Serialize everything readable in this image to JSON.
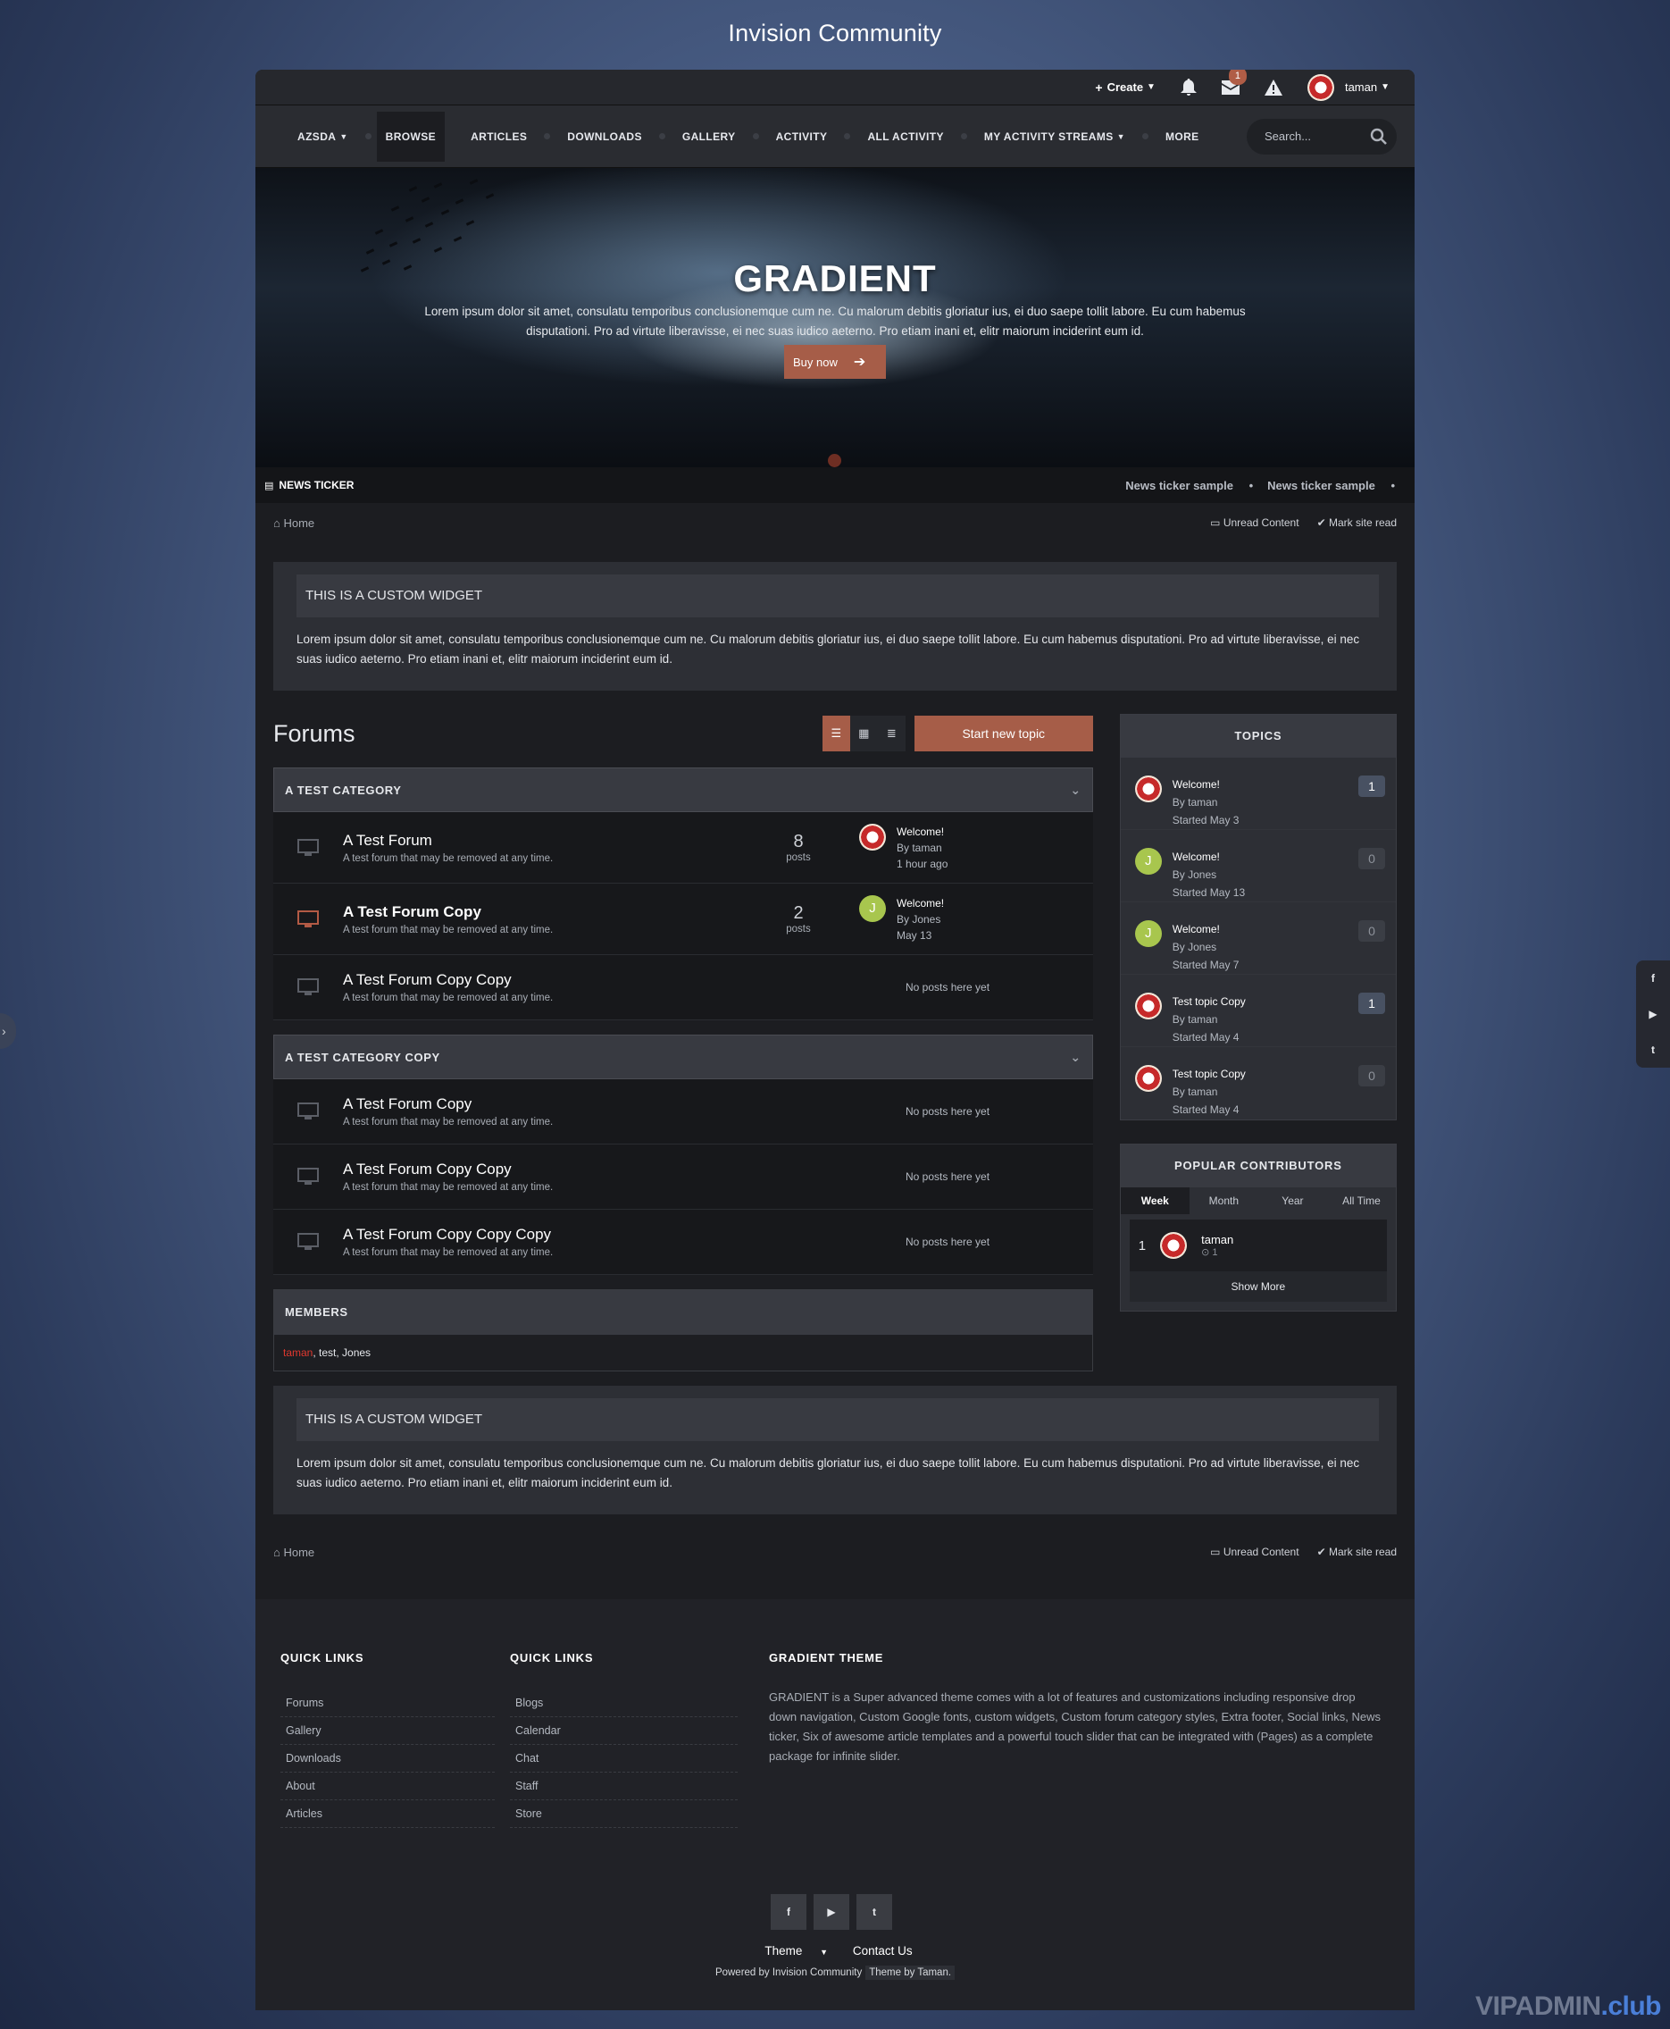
{
  "site_title": "Invision Community",
  "userbar": {
    "create": "Create",
    "messages_badge": "1",
    "username": "taman"
  },
  "nav": {
    "items": [
      "AZSDA",
      "BROWSE",
      "ARTICLES",
      "DOWNLOADS",
      "GALLERY",
      "ACTIVITY",
      "ALL ACTIVITY",
      "MY ACTIVITY STREAMS",
      "MORE"
    ],
    "search_placeholder": "Search..."
  },
  "hero": {
    "title": "GRADIENT",
    "text": "Lorem ipsum dolor sit amet, consulatu temporibus conclusionemque cum ne. Cu malorum debitis gloriatur ius, ei duo saepe tollit labore. Eu cum habemus disputationi. Pro ad virtute liberavisse, ei nec suas iudico aeterno. Pro etiam inani et, elitr maiorum inciderint eum id.",
    "button": "Buy now"
  },
  "ticker": {
    "label": "NEWS TICKER",
    "items": [
      "News ticker sample",
      "News ticker sample"
    ]
  },
  "breadcrumb": {
    "home": "Home",
    "unread": "Unread Content",
    "mark_read": "Mark site read"
  },
  "widget": {
    "title": "THIS IS A CUSTOM WIDGET",
    "text": "Lorem ipsum dolor sit amet, consulatu temporibus conclusionemque cum ne. Cu malorum debitis gloriatur ius, ei duo saepe tollit labore. Eu cum habemus disputationi. Pro ad virtute liberavisse, ei nec suas iudico aeterno. Pro etiam inani et, elitr maiorum inciderint eum id."
  },
  "forums": {
    "title": "Forums",
    "new_topic": "Start new topic",
    "categories": [
      {
        "name": "A TEST CATEGORY",
        "forums": [
          {
            "title": "A Test Forum",
            "desc": "A test forum that may be removed at any time.",
            "count": "8",
            "count_label": "posts",
            "last_title": "Welcome!",
            "last_by": "By taman",
            "last_time": "1 hour ago"
          },
          {
            "title": "A Test Forum Copy",
            "desc": "A test forum that may be removed at any time.",
            "count": "2",
            "count_label": "posts",
            "last_title": "Welcome!",
            "last_by": "By Jones",
            "last_time": "May 13"
          },
          {
            "title": "A Test Forum Copy Copy",
            "desc": "A test forum that may be removed at any time.",
            "none": "No posts here yet"
          }
        ]
      },
      {
        "name": "A TEST CATEGORY COPY",
        "forums": [
          {
            "title": "A Test Forum Copy",
            "desc": "A test forum that may be removed at any time.",
            "none": "No posts here yet"
          },
          {
            "title": "A Test Forum Copy Copy",
            "desc": "A test forum that may be removed at any time.",
            "none": "No posts here yet"
          },
          {
            "title": "A Test Forum Copy Copy Copy",
            "desc": "A test forum that may be removed at any time.",
            "none": "No posts here yet"
          }
        ]
      }
    ]
  },
  "members": {
    "title": "MEMBERS",
    "first": "taman",
    "rest": ", test, Jones"
  },
  "topics": {
    "title": "TOPICS",
    "items": [
      {
        "title": "Welcome!",
        "by": "By taman",
        "started": "Started May 3",
        "count": "1",
        "avatar_letter": ""
      },
      {
        "title": "Welcome!",
        "by": "By Jones",
        "started": "Started May 13",
        "count": "0",
        "avatar_letter": "J"
      },
      {
        "title": "Welcome!",
        "by": "By Jones",
        "started": "Started May 7",
        "count": "0",
        "avatar_letter": "J"
      },
      {
        "title": "Test topic Copy",
        "by": "By taman",
        "started": "Started May 4",
        "count": "1",
        "avatar_letter": ""
      },
      {
        "title": "Test topic Copy",
        "by": "By taman",
        "started": "Started May 4",
        "count": "0",
        "avatar_letter": ""
      }
    ]
  },
  "popular": {
    "title": "POPULAR CONTRIBUTORS",
    "tabs": [
      "Week",
      "Month",
      "Year",
      "All Time"
    ],
    "rank": "1",
    "name": "taman",
    "rep": "1",
    "show_more": "Show More"
  },
  "widget2": {
    "title": "THIS IS A CUSTOM WIDGET",
    "text": "Lorem ipsum dolor sit amet, consulatu temporibus conclusionemque cum ne. Cu malorum debitis gloriatur ius, ei duo saepe tollit labore. Eu cum habemus disputationi. Pro ad virtute liberavisse, ei nec suas iudico aeterno. Pro etiam inani et, elitr maiorum inciderint eum id."
  },
  "footer": {
    "col1_title": "QUICK LINKS",
    "col1": [
      "Forums",
      "Gallery",
      "Downloads",
      "About",
      "Articles"
    ],
    "col2_title": "QUICK LINKS",
    "col2": [
      "Blogs",
      "Calendar",
      "Chat",
      "Staff",
      "Store"
    ],
    "about_title": "GRADIENT THEME",
    "about_text": "GRADIENT is a Super advanced theme comes with a lot of features and customizations including responsive drop down navigation, Custom Google fonts, custom widgets, Custom forum category styles, Extra footer, Social links, News ticker, Six of awesome article templates and a powerful touch slider that can be integrated with (Pages) as a complete package for infinite slider.",
    "theme": "Theme",
    "contact": "Contact Us",
    "powered": "Powered by Invision Community",
    "theme_by": "Theme by Taman."
  },
  "watermark": {
    "a": "VIPADMIN",
    "b": ".club"
  }
}
